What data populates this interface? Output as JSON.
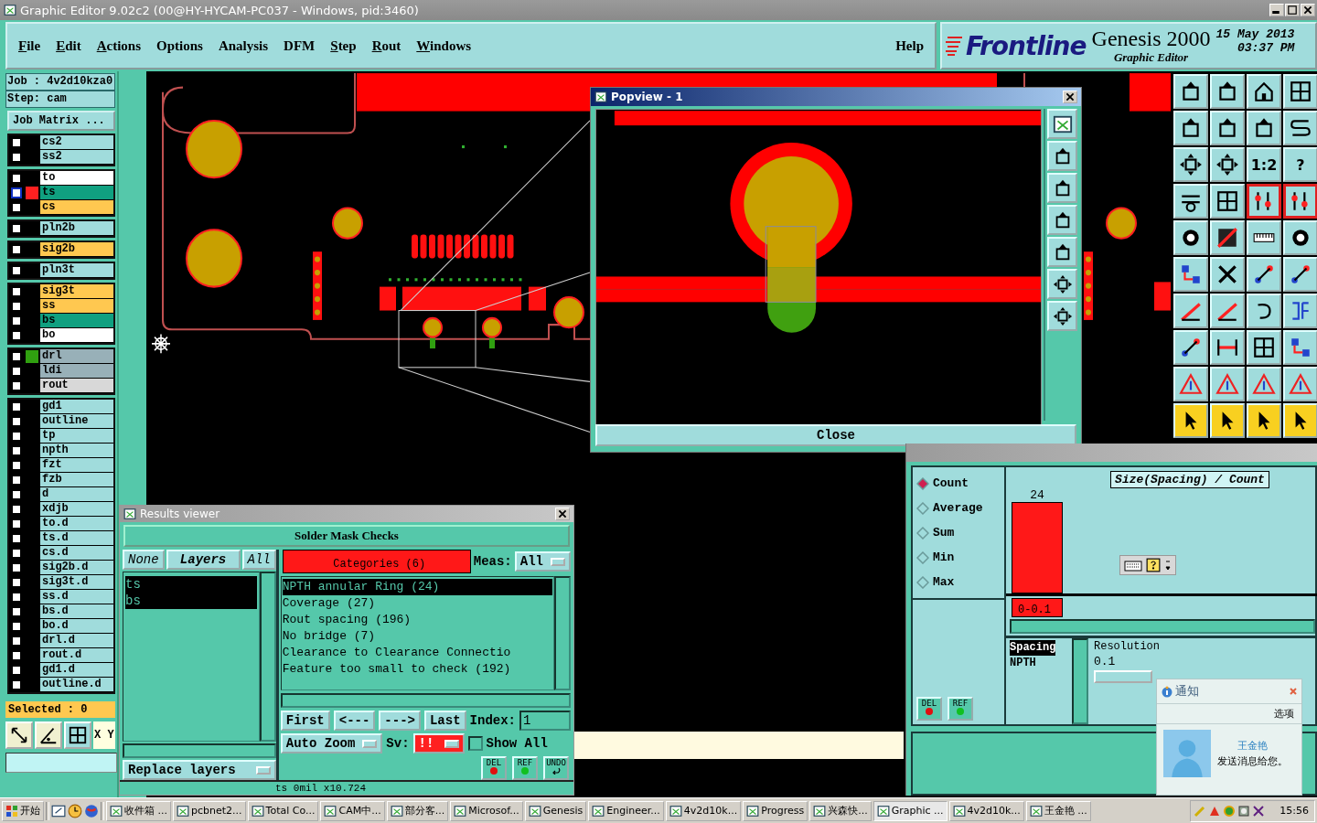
{
  "window": {
    "title": "Graphic Editor 9.02c2 (00@HY-HYCAM-PC037 - Windows, pid:3460)"
  },
  "menu": [
    {
      "label": "File",
      "underline": true
    },
    {
      "label": "Edit",
      "underline": true
    },
    {
      "label": "Actions",
      "underline": true
    },
    {
      "label": "Options",
      "underline": false
    },
    {
      "label": "Analysis",
      "underline": false
    },
    {
      "label": "DFM",
      "underline": false
    },
    {
      "label": "Step",
      "underline": true
    },
    {
      "label": "Rout",
      "underline": true
    },
    {
      "label": "Windows",
      "underline": true
    }
  ],
  "help": "Help",
  "brand": {
    "logo": "Frontline",
    "product": "Genesis 2000",
    "subtitle": "Graphic Editor",
    "date": "15 May 2013",
    "time": "03:37 PM"
  },
  "job": {
    "job": "Job : 4v2d10kza0",
    "step": "Step: cam",
    "matrix_button": "Job Matrix ..."
  },
  "layer_groups": [
    [
      {
        "name": "cs2",
        "color": "#a0dcdc",
        "checked": false,
        "selected": false,
        "highlighted": false
      },
      {
        "name": "ss2",
        "color": "#a0dcdc",
        "checked": false,
        "selected": false,
        "highlighted": false
      }
    ],
    [
      {
        "name": "to",
        "color": "#ffffff",
        "checked": false,
        "selected": false,
        "highlighted": false
      },
      {
        "name": "ts",
        "color": "#10a080",
        "checked": false,
        "selected": true,
        "highlighted": false
      },
      {
        "name": "cs",
        "color": "#ffc850",
        "checked": false,
        "selected": false,
        "highlighted": false
      }
    ],
    [
      {
        "name": "pln2b",
        "color": "#a0dcdc",
        "checked": false,
        "selected": false,
        "highlighted": false
      }
    ],
    [
      {
        "name": "sig2b",
        "color": "#ffc850",
        "checked": false,
        "selected": false,
        "highlighted": false
      }
    ],
    [
      {
        "name": "pln3t",
        "color": "#a0dcdc",
        "checked": false,
        "selected": false,
        "highlighted": false
      }
    ],
    [
      {
        "name": "sig3t",
        "color": "#ffc850",
        "checked": false,
        "selected": false,
        "highlighted": false
      },
      {
        "name": "ss",
        "color": "#ffc850",
        "checked": false,
        "selected": false,
        "highlighted": false
      },
      {
        "name": "bs",
        "color": "#10a080",
        "checked": false,
        "selected": false,
        "highlighted": false
      },
      {
        "name": "bo",
        "color": "#ffffff",
        "checked": false,
        "selected": false,
        "highlighted": false
      }
    ],
    [
      {
        "name": "drl",
        "color": "#98b0b8",
        "checked": false,
        "selected": false,
        "highlighted": true
      },
      {
        "name": "ldi",
        "color": "#98b0b8",
        "checked": false,
        "selected": false,
        "highlighted": false
      },
      {
        "name": "rout",
        "color": "#d8d8d8",
        "checked": false,
        "selected": false,
        "highlighted": false
      }
    ],
    [
      {
        "name": "gd1",
        "color": "#a0dcdc",
        "checked": false,
        "selected": false,
        "highlighted": false
      },
      {
        "name": "outline",
        "color": "#a0dcdc",
        "checked": false,
        "selected": false,
        "highlighted": false
      },
      {
        "name": "tp",
        "color": "#a0dcdc",
        "checked": false,
        "selected": false,
        "highlighted": false
      },
      {
        "name": "npth",
        "color": "#a0dcdc",
        "checked": false,
        "selected": false,
        "highlighted": false
      },
      {
        "name": "fzt",
        "color": "#a0dcdc",
        "checked": false,
        "selected": false,
        "highlighted": false
      },
      {
        "name": "fzb",
        "color": "#a0dcdc",
        "checked": false,
        "selected": false,
        "highlighted": false
      },
      {
        "name": "d",
        "color": "#a0dcdc",
        "checked": false,
        "selected": false,
        "highlighted": false
      },
      {
        "name": "xdjb",
        "color": "#a0dcdc",
        "checked": false,
        "selected": false,
        "highlighted": false
      },
      {
        "name": "to.d",
        "color": "#a0dcdc",
        "checked": false,
        "selected": false,
        "highlighted": false
      },
      {
        "name": "ts.d",
        "color": "#a0dcdc",
        "checked": false,
        "selected": false,
        "highlighted": false
      },
      {
        "name": "cs.d",
        "color": "#a0dcdc",
        "checked": false,
        "selected": false,
        "highlighted": false
      },
      {
        "name": "sig2b.d",
        "color": "#a0dcdc",
        "checked": false,
        "selected": false,
        "highlighted": false
      },
      {
        "name": "sig3t.d",
        "color": "#a0dcdc",
        "checked": false,
        "selected": false,
        "highlighted": false
      },
      {
        "name": "ss.d",
        "color": "#a0dcdc",
        "checked": false,
        "selected": false,
        "highlighted": false
      },
      {
        "name": "bs.d",
        "color": "#a0dcdc",
        "checked": false,
        "selected": false,
        "highlighted": false
      },
      {
        "name": "bo.d",
        "color": "#a0dcdc",
        "checked": false,
        "selected": false,
        "highlighted": false
      },
      {
        "name": "drl.d",
        "color": "#a0dcdc",
        "checked": false,
        "selected": false,
        "highlighted": false
      },
      {
        "name": "rout.d",
        "color": "#a0dcdc",
        "checked": false,
        "selected": false,
        "highlighted": false
      },
      {
        "name": "gd1.d",
        "color": "#a0dcdc",
        "checked": false,
        "selected": false,
        "highlighted": false
      },
      {
        "name": "outline.d",
        "color": "#a0dcdc",
        "checked": false,
        "selected": false,
        "highlighted": false
      }
    ]
  ],
  "selected_count": "Selected : 0",
  "coord_label": "X Y",
  "right_toolbar": {
    "labels": [
      "1:2",
      "?"
    ]
  },
  "popview": {
    "title": "Popview - 1",
    "close": "Close"
  },
  "results": {
    "title": "Results viewer",
    "header": "Solder Mask Checks",
    "layer_buttons": [
      "None",
      "Layers",
      "All"
    ],
    "layers": [
      {
        "name": "ts",
        "selected": true
      },
      {
        "name": "bs",
        "selected": true
      }
    ],
    "replace": "Replace layers",
    "categories_button": "Categories (6)",
    "meas_label": "Meas:",
    "meas_value": "All",
    "categories": [
      {
        "label": "NPTH annular Ring (24)",
        "selected": true
      },
      {
        "label": "Coverage (27)",
        "selected": false
      },
      {
        "label": "Rout spacing (196)",
        "selected": false
      },
      {
        "label": "No bridge (7)",
        "selected": false
      },
      {
        "label": "Clearance to Clearance Connectio",
        "selected": false
      },
      {
        "label": "Feature too small to check (192)",
        "selected": false
      }
    ],
    "nav": [
      "First",
      "<---",
      "--->",
      "Last"
    ],
    "index_label": "Index:",
    "index_value": "1",
    "zoom": "Auto Zoom",
    "sv_label": "Sv:",
    "sv_value": "!!",
    "show_all": {
      "label": "Show All",
      "checked": false
    },
    "actions": [
      {
        "label": "DEL",
        "kind": "delete"
      },
      {
        "label": "REF",
        "kind": "refresh"
      },
      {
        "label": "UNDO",
        "kind": "undo"
      }
    ],
    "status": "ts  0mil  x10.724"
  },
  "histogram": {
    "modes": [
      {
        "label": "Count",
        "selected": true
      },
      {
        "label": "Average",
        "selected": false
      },
      {
        "label": "Sum",
        "selected": false
      },
      {
        "label": "Min",
        "selected": false
      },
      {
        "label": "Max",
        "selected": false
      }
    ],
    "actions": [
      {
        "label": "DEL",
        "kind": "delete"
      },
      {
        "label": "REF",
        "kind": "refresh"
      }
    ],
    "chart": {
      "title": "Size(Spacing) / Count",
      "value": "24",
      "category": "0-0.1"
    },
    "measures": [
      {
        "label": "Spacing",
        "selected": true
      },
      {
        "label": "NPTH",
        "selected": false
      }
    ],
    "resolution_label": "Resolution",
    "resolution_value": "0.1"
  },
  "notification": {
    "title": "通知",
    "options": "选项",
    "sender": "王金艳",
    "message": "发送消息给您。"
  },
  "taskbar": {
    "start": "开始",
    "tasks": [
      {
        "label": "收件箱 ...",
        "selected": false
      },
      {
        "label": "pcbnet2...",
        "selected": false
      },
      {
        "label": "Total Co...",
        "selected": false
      },
      {
        "label": "CAM中...",
        "selected": false
      },
      {
        "label": "部分客...",
        "selected": false
      },
      {
        "label": "Microsof...",
        "selected": false
      },
      {
        "label": "Genesis",
        "selected": false
      },
      {
        "label": "Engineer...",
        "selected": false
      },
      {
        "label": "4v2d10k...",
        "selected": false
      },
      {
        "label": "Progress",
        "selected": false
      },
      {
        "label": "兴森快...",
        "selected": false
      },
      {
        "label": "Graphic ...",
        "selected": true
      },
      {
        "label": "4v2d10k...",
        "selected": false
      },
      {
        "label": "王金艳 ...",
        "selected": false
      }
    ],
    "clock": "15:56"
  }
}
